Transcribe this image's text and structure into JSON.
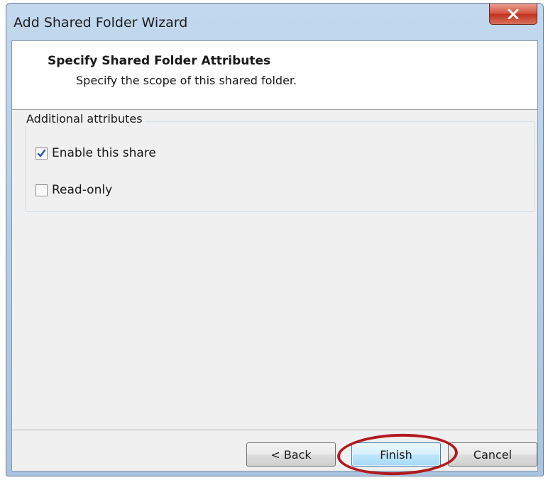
{
  "window": {
    "title": "Add Shared Folder Wizard",
    "close_icon": "close-x-icon"
  },
  "header": {
    "title": "Specify Shared Folder Attributes",
    "subtitle": "Specify the scope of this shared folder."
  },
  "attributes": {
    "group_label": "Additional attributes",
    "options": [
      {
        "label": "Enable this share",
        "checked": true
      },
      {
        "label": "Read-only",
        "checked": false
      }
    ]
  },
  "buttons": {
    "back": "< Back",
    "finish": "Finish",
    "cancel": "Cancel"
  },
  "colors": {
    "accent_annotation": "#b11a1f",
    "title_bar": "#b9d1ea",
    "close_button": "#c7432f"
  }
}
